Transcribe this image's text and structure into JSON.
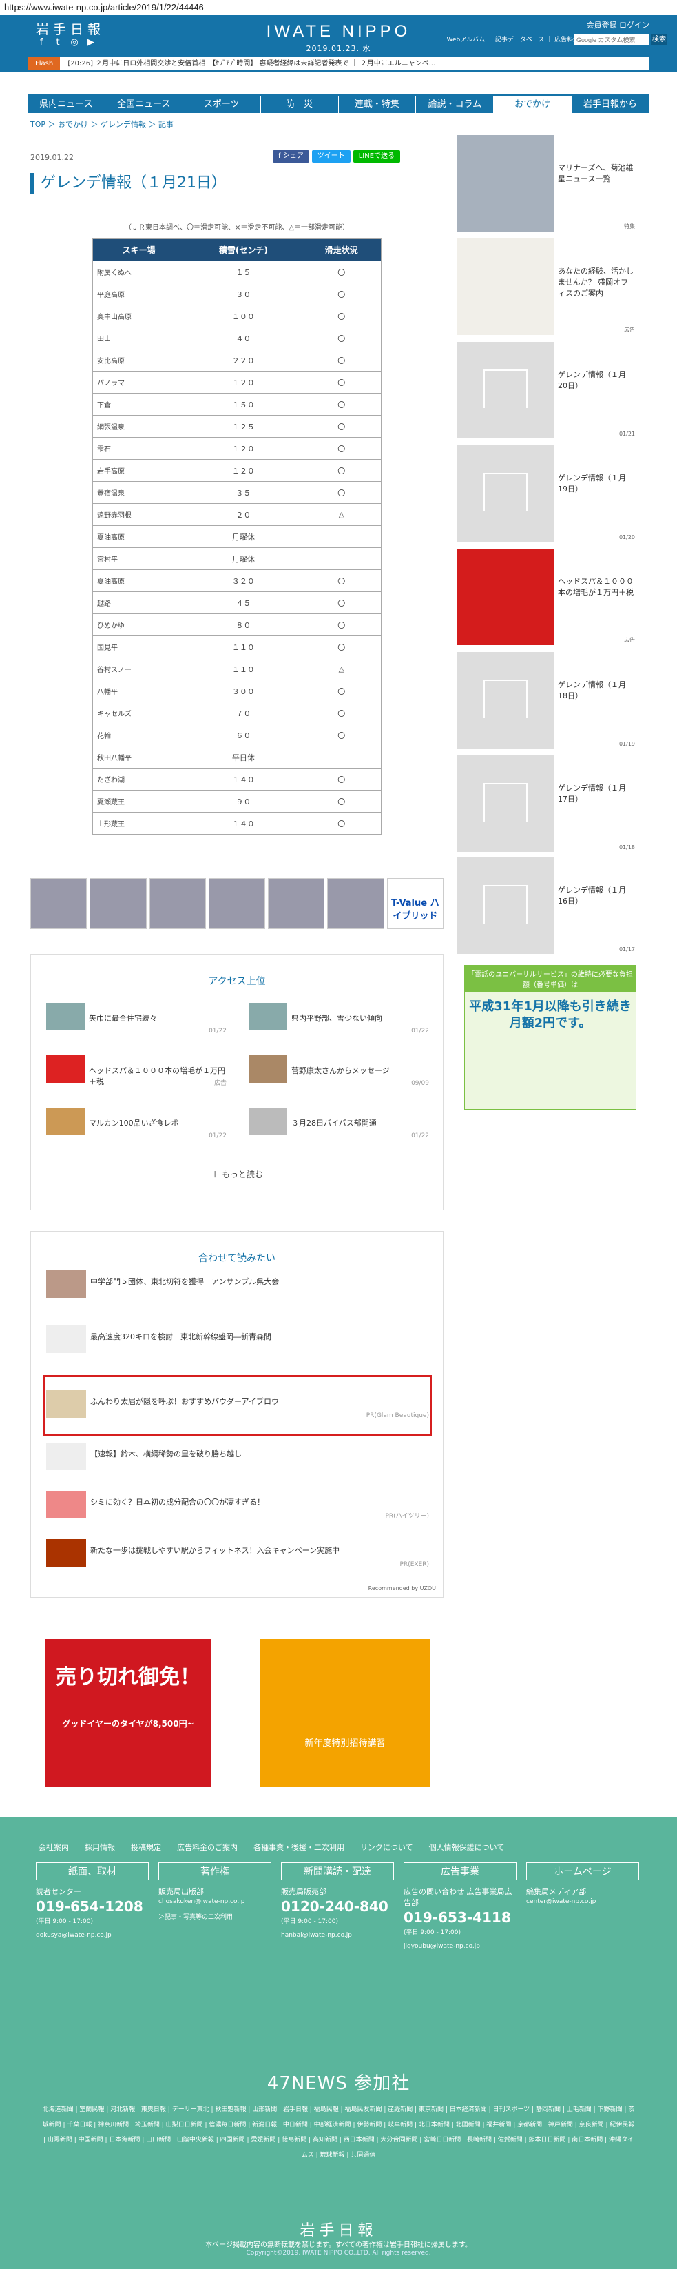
{
  "browser": {
    "url": "https://www.iwate-np.co.jp/article/2019/1/22/44446"
  },
  "header": {
    "logo_jp": "岩手日報",
    "logo_en": "IWATE NIPPO",
    "date": "2019.01.23. 水",
    "member_links": "会員登録  ログイン",
    "links": "Webアルバム ｜ 記事データベース ｜ 広告料金 ｜",
    "search_placeholder": "Google カスタム検索",
    "search_button": "検索"
  },
  "flash": {
    "tag": "Flash",
    "text": "[20:26] ２月中に日ロ外相間交渉と安倍首相　【ｾﾌﾞｱﾌﾟ時間】 容疑者経緯は未詳記者発表で ｜ ２月中にエルニャンペ..."
  },
  "nav": [
    "県内ニュース",
    "全国ニュース",
    "スポーツ",
    "防　災",
    "連載・特集",
    "論説・コラム",
    "おでかけ",
    "岩手日報から"
  ],
  "breadcrumb": "TOP ＞ おでかけ ＞ ゲレンデ情報 ＞ 記事",
  "article": {
    "date": "2019.01.22",
    "share": [
      "f シェア",
      "ツイート",
      "LINEで送る"
    ],
    "title": "ゲレンデ情報（１月21日）",
    "note": "（ＪＲ東日本調べ、〇＝滑走可能、×＝滑走不可能、△＝一部滑走可能）",
    "table_headers": [
      "スキー場",
      "積雪(センチ)",
      "滑走状況"
    ],
    "rows": [
      [
        "附属くぬへ",
        "１５",
        "〇"
      ],
      [
        "平庭高原",
        "３０",
        "〇"
      ],
      [
        "奥中山高原",
        "１００",
        "〇"
      ],
      [
        "田山",
        "４０",
        "〇"
      ],
      [
        "安比高原",
        "２２０",
        "〇"
      ],
      [
        "パノラマ",
        "１２０",
        "〇"
      ],
      [
        "下倉",
        "１５０",
        "〇"
      ],
      [
        "網張温泉",
        "１２５",
        "〇"
      ],
      [
        "雫石",
        "１２０",
        "〇"
      ],
      [
        "岩手高原",
        "１２０",
        "〇"
      ],
      [
        "鶯宿温泉",
        "３５",
        "〇"
      ],
      [
        "遠野赤羽根",
        "２０",
        "△"
      ],
      [
        "夏油高原",
        "月曜休",
        ""
      ],
      [
        "宮村平",
        "月曜休",
        ""
      ],
      [
        "夏油高原",
        "３２０",
        "〇"
      ],
      [
        "越路",
        "４５",
        "〇"
      ],
      [
        "ひめかゆ",
        "８０",
        "〇"
      ],
      [
        "国見平",
        "１１０",
        "〇"
      ],
      [
        "谷村スノー",
        "１１０",
        "△"
      ],
      [
        "八幡平",
        "３００",
        "〇"
      ],
      [
        "キャセルズ",
        "７０",
        "〇"
      ],
      [
        "花輪",
        "６０",
        "〇"
      ],
      [
        "秋田八幡平",
        "平日休",
        ""
      ],
      [
        "たざわ湖",
        "１４０",
        "〇"
      ],
      [
        "夏瀬蔵王",
        "９０",
        "〇"
      ],
      [
        "山形蔵王",
        "１４０",
        "〇"
      ]
    ]
  },
  "ad_cars": {
    "brand": "T-Value ハイブリッド"
  },
  "access": {
    "title": "アクセス上位",
    "items": [
      {
        "text": "矢巾に最合住宅続々",
        "date": "01/22"
      },
      {
        "text": "県内平野部、雪少ない傾向",
        "date": "01/22"
      },
      {
        "text": "ヘッドスパ＆１０００本の増毛が１万円＋税",
        "date": "広告"
      },
      {
        "text": "菅野康太さんからメッセージ",
        "date": "09/09"
      },
      {
        "text": "マルカン100品いざ食レポ",
        "date": "01/22"
      },
      {
        "text": "３月28日バイパス部開通",
        "date": "01/22"
      }
    ],
    "more": "もっと読む"
  },
  "related": {
    "title": "合わせて読みたい",
    "items": [
      {
        "text": "中学部門５団体、東北切符を獲得　アンサンブル県大会",
        "src": ""
      },
      {
        "text": "最高速度320キロを検討　東北新幹線盛岡―新青森間",
        "src": ""
      },
      {
        "text": "ふんわり太眉が隠を呼ぶ！おすすめパウダーアイブロウ",
        "src": "PR(Glam Beautique)"
      },
      {
        "text": "【速報】鈴木、横綱稀勢の里を破り勝ち越し",
        "src": ""
      },
      {
        "text": "シミに効く？日本初の成分配合の〇〇が凄すぎる！",
        "src": "PR(ハイツリー)"
      },
      {
        "text": "新たな一歩は挑戦しやすい駅からフィットネス！入会キャンペーン実施中",
        "src": "PR(EXER)"
      }
    ],
    "reco": "Recommended by UZOU"
  },
  "ads_bottom": {
    "tire_title": "売り切れ御免！",
    "tire_sub": "グッドイヤーのタイヤが8,500円~",
    "show_title": "新年度特別招待講習"
  },
  "sidebar": {
    "items": [
      {
        "text": "マリナーズへ、菊池雄星ニュース一覧",
        "date": "特集"
      },
      {
        "text": "あなたの経験、活かしませんか？ 盛岡オフィスのご案内",
        "date": "広告"
      },
      {
        "text": "ゲレンデ情報（１月20日）",
        "date": "01/21"
      },
      {
        "text": "ゲレンデ情報（１月19日）",
        "date": "01/20"
      },
      {
        "text": "ヘッドスパ＆１０００本の増毛が１万円＋税",
        "date": "広告"
      },
      {
        "text": "ゲレンデ情報（１月18日）",
        "date": "01/19"
      },
      {
        "text": "ゲレンデ情報（１月17日）",
        "date": "01/18"
      },
      {
        "text": "ゲレンデ情報（１月16日）",
        "date": "01/17"
      }
    ],
    "ad_title": "「電話のユニバーサルサービス」の維持に必要な負担額（番号単価）は",
    "ad_big": "平成31年1月以降も引き続き月額2円です。"
  },
  "footer": {
    "links": [
      "会社案内",
      "採用情報",
      "投稿規定",
      "広告料金のご案内",
      "各種事業・後援・二次利用",
      "リンクについて",
      "個人情報保護について"
    ],
    "cols": [
      {
        "head": "紙面、取材",
        "l1": "読者センター",
        "tel": "019-654-1208",
        "sm": "(平日 9:00 - 17:00)",
        "ml": "dokusya@iwate-np.co.jp"
      },
      {
        "head": "著作権",
        "l1": "販売局出版部",
        "tel": "",
        "sm": "chosakuken@iwate-np.co.jp",
        "ml": "＞記事・写真等の二次利用"
      },
      {
        "head": "新聞購読・配達",
        "l1": "販売局販売部",
        "tel": "0120-240-840",
        "sm": "(平日 9:00 - 17:00)",
        "ml": "hanbai@iwate-np.co.jp"
      },
      {
        "head": "広告事業",
        "l1": "広告の問い合わせ 広告事業局広告部",
        "tel": "019-653-4118",
        "sm": "(平日 9:00 - 17:00)",
        "ml": "jigyoubu@iwate-np.co.jp"
      },
      {
        "head": "ホームページ",
        "l1": "編集局メディア部",
        "tel": "",
        "sm": "center@iwate-np.co.jp",
        "ml": ""
      }
    ],
    "f47": "47NEWS 参加社",
    "f47_list": "北海道新聞 | 室蘭民報 | 河北新報 | 東奥日報 | デーリー東北 | 秋田魁新報 | 山形新聞 | 岩手日報 | 福島民報 | 福島民友新聞 | 産経新聞 | 東京新聞 | 日本経済新聞 | 日刊スポーツ | 静岡新聞 | 上毛新聞 | 下野新聞 | 茨城新聞 | 千葉日報 | 神奈川新聞 | 埼玉新聞 | 山梨日日新聞 | 信濃毎日新聞 | 新潟日報 | 中日新聞 | 中部経済新聞 | 伊勢新聞 | 岐阜新聞 | 北日本新聞 | 北國新聞 | 福井新聞 | 京都新聞 | 神戸新聞 | 奈良新聞 | 紀伊民報 | 山陽新聞 | 中国新聞 | 日本海新聞 | 山口新聞 | 山陰中央新報 | 四国新聞 | 愛媛新聞 | 徳島新聞 | 高知新聞 | 西日本新聞 | 大分合同新聞 | 宮崎日日新聞 | 長崎新聞 | 佐賀新聞 | 熊本日日新聞 | 南日本新聞 | 沖縄タイムス | 琉球新報 | 共同通信",
    "logo": "岩手日報",
    "copy1": "本ページ掲載内容の無断転載を禁じます。すべての著作権は岩手日報社に帰属します。",
    "copy2": "Copyright©2019, IWATE NIPPO CO.,LTD. All rights reserved."
  }
}
